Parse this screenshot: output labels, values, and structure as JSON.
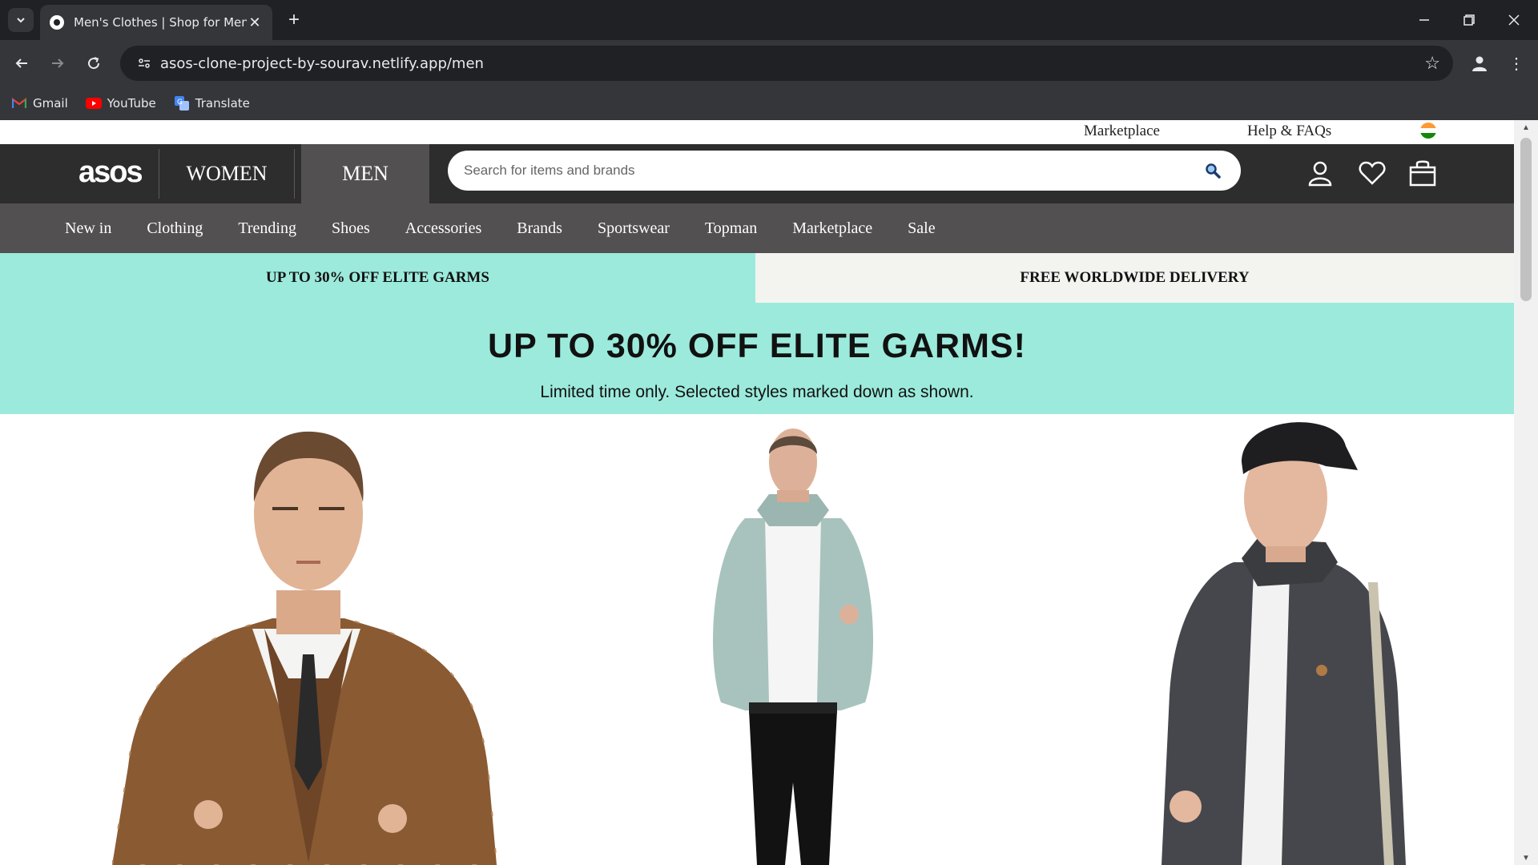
{
  "browser": {
    "tab_title": "Men's Clothes | Shop for Men's",
    "url": "asos-clone-project-by-sourav.netlify.app/men",
    "bookmarks": [
      {
        "label": "Gmail",
        "icon": "gmail-icon"
      },
      {
        "label": "YouTube",
        "icon": "youtube-icon"
      },
      {
        "label": "Translate",
        "icon": "translate-icon"
      }
    ]
  },
  "site": {
    "utility_links": {
      "marketplace": "Marketplace",
      "help": "Help & FAQs"
    },
    "logo": "asos",
    "gender_tabs": {
      "women": "WOMEN",
      "men": "MEN"
    },
    "search": {
      "placeholder": "Search for items and brands"
    },
    "categories": [
      "New in",
      "Clothing",
      "Trending",
      "Shoes",
      "Accessories",
      "Brands",
      "Sportswear",
      "Topman",
      "Marketplace",
      "Sale"
    ],
    "promo_strip": {
      "left": "UP TO 30% OFF ELITE GARMS",
      "right": "FREE WORLDWIDE DELIVERY"
    },
    "hero": {
      "title": "UP TO 30% OFF ELITE GARMS!",
      "subtitle": "Limited time only. Selected styles marked down as shown."
    }
  },
  "colors": {
    "header_dark": "#2d2d2d",
    "nav_gray": "#525050",
    "promo_mint": "#9ceadc",
    "promo_light": "#f3f3f0"
  }
}
